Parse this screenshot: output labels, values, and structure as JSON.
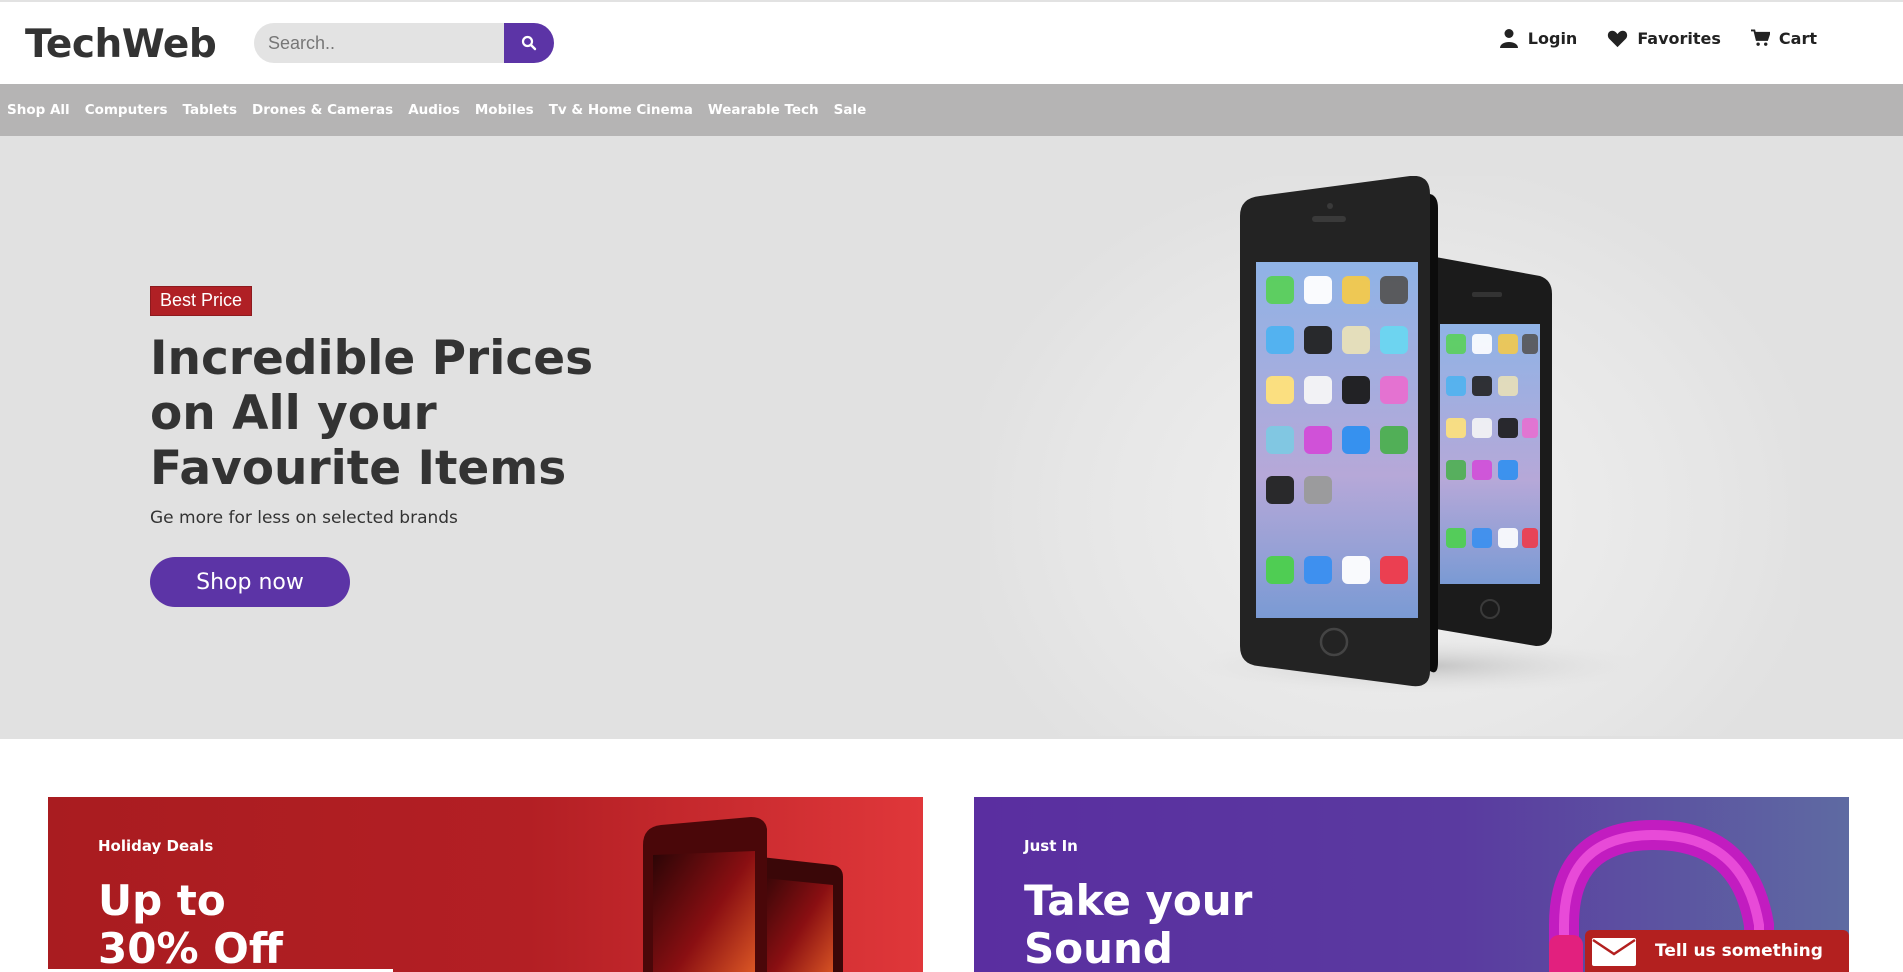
{
  "brand": {
    "logo_text": "TechWeb",
    "accent": "#5c34a6",
    "red": "#b02025"
  },
  "search": {
    "placeholder": "Search..",
    "button_icon": "search-icon"
  },
  "header_links": [
    {
      "label": "Login",
      "icon": "user-icon"
    },
    {
      "label": "Favorites",
      "icon": "heart-icon"
    },
    {
      "label": "Cart",
      "icon": "cart-icon"
    }
  ],
  "categories": [
    "Shop All",
    "Computers",
    "Tablets",
    "Drones & Cameras",
    "Audios",
    "Mobiles",
    "Tv & Home Cinema",
    "Wearable Tech",
    "Sale"
  ],
  "hero": {
    "badge": "Best Price",
    "title": "Incredible Prices on All your Favourite Items",
    "subtitle": "Ge more for less on selected brands",
    "cta": "Shop now",
    "image": "smartphones-image",
    "background": "#e1e1e1"
  },
  "promos": [
    {
      "kicker": "Holiday Deals",
      "title_line1": "Up to",
      "title_line2": "30% Off",
      "image": "phone-image"
    },
    {
      "kicker": "Just In",
      "title_line1": "Take your",
      "title_line2": "Sound",
      "image": "headphones-image"
    }
  ],
  "feedback": {
    "label": "Tell us something",
    "icon": "envelope-icon"
  }
}
